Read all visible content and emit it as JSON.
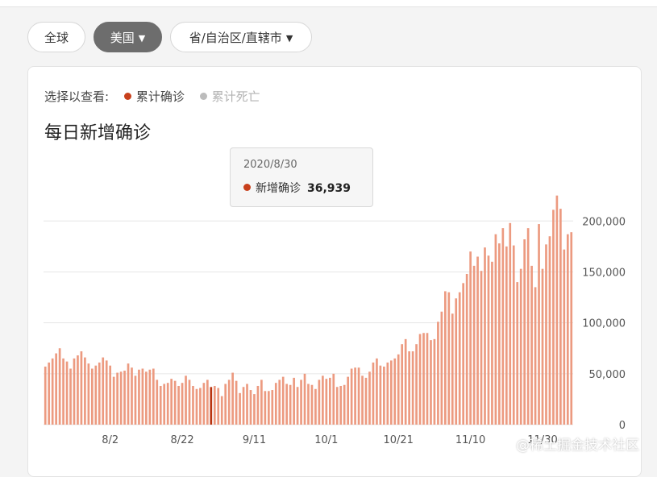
{
  "tabs": [
    {
      "label": "全球",
      "active": false,
      "has_caret": false
    },
    {
      "label": "美国",
      "active": true,
      "has_caret": true
    },
    {
      "label": "省/自治区/直辖市",
      "active": false,
      "has_caret": true
    }
  ],
  "selector": {
    "prompt": "选择以查看:",
    "options": [
      {
        "label": "累计确诊",
        "active": true,
        "color": "#c8401c"
      },
      {
        "label": "累计死亡",
        "active": false,
        "color": "#bcbcbc"
      }
    ]
  },
  "tooltip": {
    "date": "2020/8/30",
    "series_label": "新增确诊",
    "value": "36,939",
    "dot_color": "#c8401c"
  },
  "watermark": "@稀土掘金技术社区",
  "colors": {
    "bar": "#ec9a80",
    "highlight": "#b8330f",
    "grid": "#e6e6e6",
    "axis_text": "#555555"
  },
  "chart_data": {
    "type": "bar",
    "title": "每日新增确诊",
    "xlabel": "",
    "ylabel": "",
    "ylim": [
      0,
      220000
    ],
    "y_ticks": [
      0,
      50000,
      100000,
      150000,
      200000
    ],
    "y_tick_labels": [
      "0",
      "50,000",
      "100,000",
      "150,000",
      "200,000"
    ],
    "y_axis_side": "right",
    "grid": true,
    "legend": "none",
    "x_tick_labels": [
      "8/2",
      "8/22",
      "9/11",
      "10/1",
      "10/21",
      "11/10",
      "11/30"
    ],
    "x_tick_indices": [
      18,
      38,
      58,
      78,
      98,
      118,
      138
    ],
    "highlight_index": 46,
    "values": [
      57000,
      61000,
      65000,
      70000,
      75000,
      65000,
      62000,
      55000,
      65000,
      68000,
      72000,
      66000,
      60000,
      55000,
      58000,
      61000,
      66000,
      63000,
      58000,
      47000,
      51000,
      52000,
      53000,
      60000,
      56000,
      48000,
      54000,
      55000,
      52000,
      54000,
      55000,
      44000,
      38000,
      40000,
      41000,
      45000,
      43000,
      38000,
      41000,
      48000,
      44000,
      38000,
      35000,
      36000,
      41000,
      44000,
      36939,
      38000,
      36000,
      28000,
      40000,
      44000,
      51000,
      43000,
      31000,
      37000,
      40000,
      34000,
      30000,
      38000,
      44000,
      33000,
      33000,
      34000,
      41000,
      44000,
      47000,
      40000,
      39000,
      46000,
      37000,
      44000,
      50000,
      40000,
      39000,
      35000,
      44000,
      48000,
      45000,
      46000,
      50000,
      37000,
      38000,
      39000,
      47000,
      55000,
      56000,
      56000,
      48000,
      46000,
      52000,
      61000,
      65000,
      58000,
      57000,
      61000,
      63000,
      65000,
      69000,
      79000,
      84000,
      72000,
      72000,
      79000,
      89000,
      90000,
      90000,
      83000,
      84000,
      101000,
      111000,
      131000,
      130000,
      109000,
      124000,
      130000,
      139000,
      148000,
      170000,
      156000,
      165000,
      151000,
      174000,
      166000,
      160000,
      187000,
      178000,
      193000,
      175000,
      198000,
      176000,
      140000,
      153000,
      182000,
      193000,
      156000,
      135000,
      197000,
      153000,
      177000,
      185000,
      211000,
      225000,
      212000,
      172000,
      187000,
      189000
    ]
  }
}
